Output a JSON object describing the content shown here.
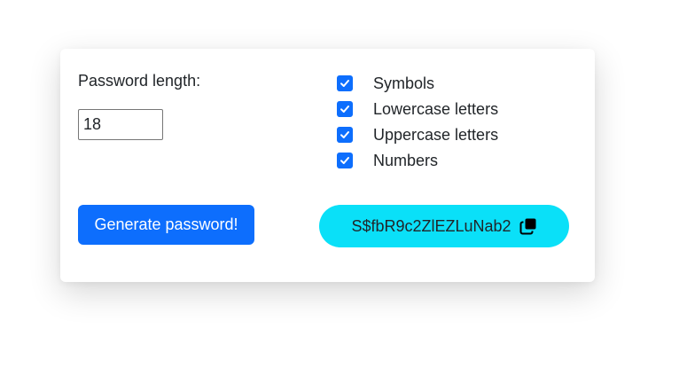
{
  "form": {
    "length_label": "Password length:",
    "length_value": "18"
  },
  "options": [
    {
      "label": "Symbols",
      "checked": true
    },
    {
      "label": "Lowercase letters",
      "checked": true
    },
    {
      "label": "Uppercase letters",
      "checked": true
    },
    {
      "label": "Numbers",
      "checked": true
    }
  ],
  "actions": {
    "generate_label": "Generate password!"
  },
  "result": {
    "password": "S$fbR9c2ZlEZLuNab2",
    "icon": "copy-icon"
  },
  "colors": {
    "primary": "#0d6efd",
    "result_background": "#0ae0f8",
    "text": "#212529"
  }
}
